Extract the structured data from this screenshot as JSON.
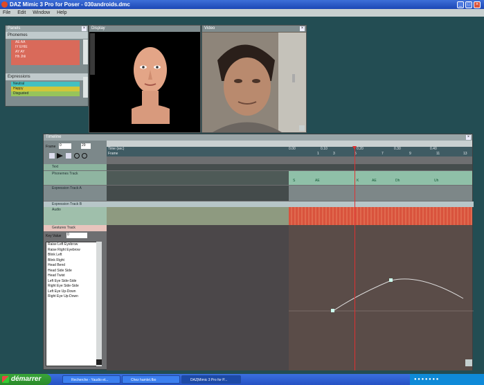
{
  "window": {
    "title": "DAZ Mimic 3 Pro for Poser - 030androids.dmc"
  },
  "menu": [
    "File",
    "Edit",
    "Window",
    "Help"
  ],
  "panels": {
    "panel_title": "Panels",
    "phonemes_label": "Phonemes",
    "phonemes": [
      "AE AA",
      "IY EHIE",
      "AY AY",
      "Hh Jhli"
    ],
    "expressions_label": "Expressions",
    "expressions": [
      "Neutral",
      "Happy",
      "Disgusted"
    ],
    "display_title": "Display",
    "video_title": "Video"
  },
  "timeline": {
    "title": "Timeline",
    "frame_label": "Frame",
    "frame_value": "0",
    "frame_end": "29",
    "time_label": "Time (sec)",
    "frame_row_label": "Frame",
    "ticks_time": [
      "0.00",
      "0.10",
      "0.20",
      "0.30",
      "0.40"
    ],
    "ticks_frame": [
      "1",
      "3",
      "5",
      "7",
      "9",
      "11",
      "13"
    ],
    "tracks": {
      "text": "Text",
      "phonemes": "Phonemes Track",
      "expression_a": "Expression Track A",
      "expression_b": "Expression Track B",
      "audio": "Audio",
      "gestures": "Gestures Track"
    },
    "phoneme_marks": [
      "S",
      "AE",
      "K",
      "AE",
      "Dh",
      "Uh"
    ],
    "key_value_label": "Key Value",
    "key_value": "0",
    "gestures": [
      "Raise Left Eyebrow",
      "Raise Right Eyebrow",
      "Blink Left",
      "Blink Right",
      "Head Bend",
      "Head Side Side",
      "Head Twist",
      "Left Eye Side-Side",
      "Right Eye Side-Side",
      "Left Eye Up-Down",
      "Right Eye Up-Down"
    ]
  },
  "taskbar": {
    "start": "démarrer",
    "tasks": [
      "Recherche - Yaudio et...",
      "Chez hamlet.fbo",
      "DAZ|Mimic 3 Pro for P..."
    ]
  },
  "colors": {
    "accent": "#d9533d",
    "timeline_bg": "#5a4c48",
    "track_green": "#8fb5a1"
  }
}
